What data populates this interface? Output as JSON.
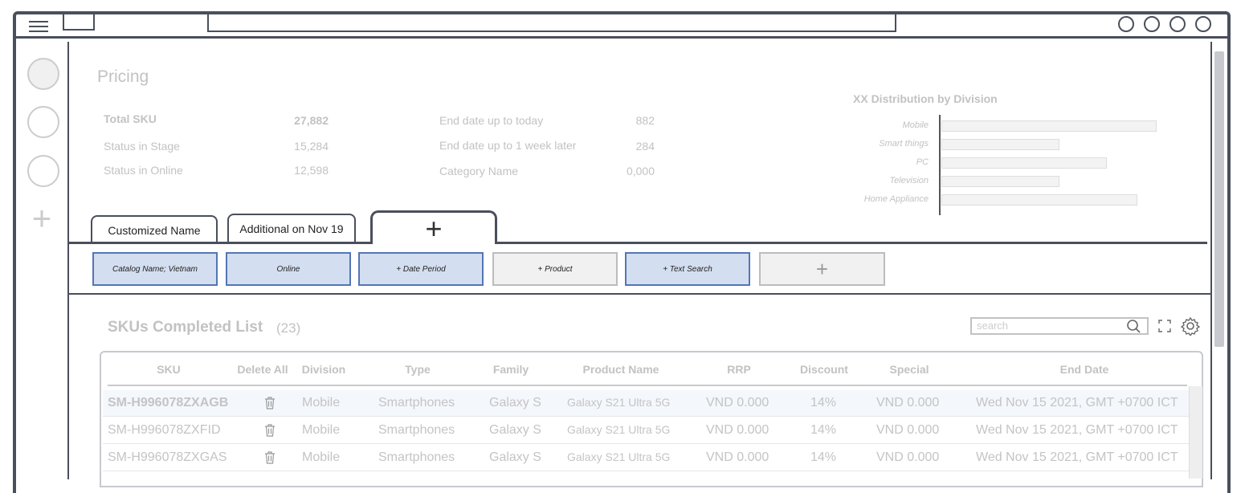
{
  "window": {
    "search_placeholder": ""
  },
  "page": {
    "title": "Pricing"
  },
  "stats_left": [
    {
      "label": "Total SKU",
      "value": "27,882"
    },
    {
      "label": "Status in Stage",
      "value": "15,284"
    },
    {
      "label": "Status in Online",
      "value": "12,598"
    }
  ],
  "stats_right": [
    {
      "label": "End date up to today",
      "value": "882"
    },
    {
      "label": "End date up to 1 week later",
      "value": "284"
    },
    {
      "label": "Category Name",
      "value": "0,000"
    }
  ],
  "chart_data": {
    "type": "bar",
    "title": "XX Distribution by Division",
    "orientation": "horizontal",
    "categories": [
      "Mobile",
      "Smart things",
      "PC",
      "Television",
      "Home Appliance"
    ],
    "values": [
      100,
      55,
      77,
      55,
      91
    ],
    "xlim": [
      0,
      100
    ],
    "grid": false
  },
  "tabs": [
    {
      "label": "Customized Name"
    },
    {
      "label": "Additional on Nov 19"
    },
    {
      "label": "+"
    }
  ],
  "filters": [
    {
      "label": "Catalog Name; Vietnam",
      "active": true
    },
    {
      "label": "Online",
      "active": true
    },
    {
      "label": "+ Date Period",
      "active": true
    },
    {
      "label": "+ Product",
      "active": false
    },
    {
      "label": "+ Text Search",
      "active": true
    },
    {
      "label": "+",
      "active": false
    }
  ],
  "list": {
    "title": "SKUs Completed List",
    "count": "(23)",
    "search_placeholder": "search",
    "columns": [
      "SKU",
      "Delete All",
      "Division",
      "Type",
      "Family",
      "Product Name",
      "RRP",
      "Discount",
      "Special",
      "End Date"
    ],
    "rows": [
      {
        "sku": "SM-H996078ZXAGB",
        "division": "Mobile",
        "type": "Smartphones",
        "family": "Galaxy S",
        "product": "Galaxy S21 Ultra 5G",
        "rrp": "VND 0.000",
        "discount": "14%",
        "special": "VND 0.000",
        "end": "Wed Nov 15 2021, GMT +0700 ICT"
      },
      {
        "sku": "SM-H996078ZXFID",
        "division": "Mobile",
        "type": "Smartphones",
        "family": "Galaxy S",
        "product": "Galaxy S21 Ultra 5G",
        "rrp": "VND 0.000",
        "discount": "14%",
        "special": "VND 0.000",
        "end": "Wed Nov 15 2021, GMT +0700 ICT"
      },
      {
        "sku": "SM-H996078ZXGAS",
        "division": "Mobile",
        "type": "Smartphones",
        "family": "Galaxy S",
        "product": "Galaxy S21 Ultra 5G",
        "rrp": "VND 0.000",
        "discount": "14%",
        "special": "VND 0.000",
        "end": "Wed Nov 15 2021, GMT +0700 ICT"
      }
    ]
  },
  "colors": {
    "frame": "#4a4f5c",
    "filter_active_bg": "#d3dff0",
    "filter_active_border": "#5475b5",
    "muted_text": "#c2c2c2"
  }
}
